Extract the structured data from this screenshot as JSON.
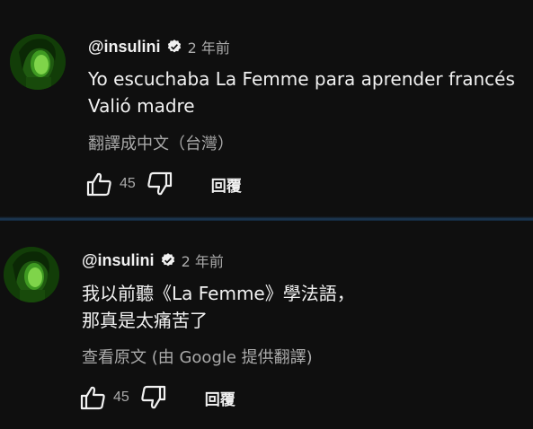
{
  "comments": [
    {
      "handle": "@insulini",
      "time": "2 年前",
      "text_lines": [
        "Yo escuchaba La Femme para aprender francés",
        "Valió madre"
      ],
      "translate_label": "翻譯成中文（台灣）",
      "likes": "45",
      "reply_label": "回覆"
    },
    {
      "handle": "@insulini",
      "time": "2 年前",
      "text_lines": [
        "我以前聽《La Femme》學法語，",
        "那真是太痛苦了"
      ],
      "translate_label": "查看原文 (由 Google 提供翻譯)",
      "likes": "45",
      "reply_label": "回覆"
    }
  ],
  "icons": {
    "verified": "verified-check-icon",
    "like": "thumbs-up-icon",
    "dislike": "thumbs-down-icon"
  },
  "colors": {
    "background": "#0f0f0f",
    "text": "#f1f1f1",
    "secondary": "#aaaaaa",
    "divider": "#1d3a56"
  }
}
